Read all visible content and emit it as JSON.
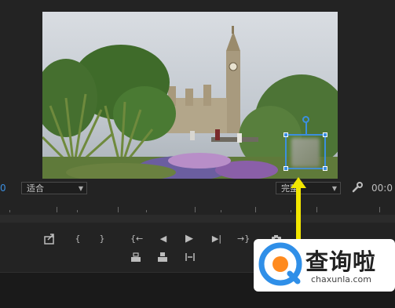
{
  "timecode_left": "0",
  "timecode_right": "00:0",
  "fit_select": {
    "value": "适合"
  },
  "quality_select": {
    "value": "完整"
  },
  "transport": {
    "mark_in": "{",
    "mark_out": "}",
    "go_in": "{←",
    "step_back": "◀",
    "play": "▶",
    "step_forward": "▶|",
    "go_out": "→}"
  },
  "icons": [
    "export-frame-icon",
    "mark-in-icon",
    "mark-out-icon",
    "go-to-in-icon",
    "step-back-icon",
    "play-icon",
    "step-forward-icon",
    "go-to-out-icon",
    "camera-icon",
    "lift-icon",
    "extract-icon",
    "trim-icon",
    "wrench-icon"
  ],
  "watermark": {
    "brand": "查询啦",
    "url": "chaxunla.com"
  },
  "colors": {
    "accent": "#3b8fe0",
    "arrow": "#f2e600",
    "timecode": "#3c8fe0"
  }
}
